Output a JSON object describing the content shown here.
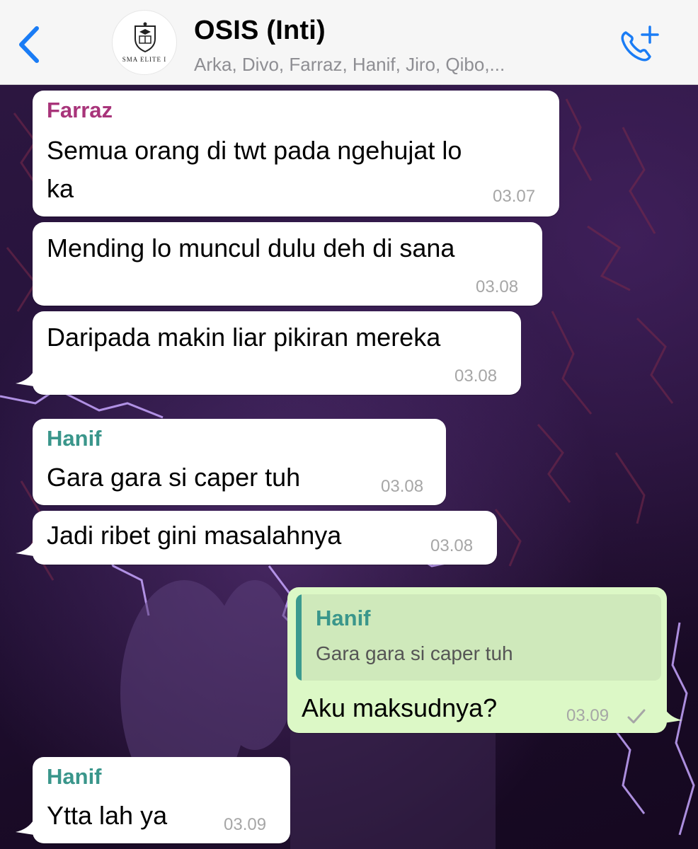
{
  "header": {
    "title": "OSIS (Inti)",
    "subtitle": "Arka, Divo, Farraz, Hanif, Jiro, Qibo,...",
    "avatar_text": "SMA ELITE I",
    "back_icon": "chevron-left-icon",
    "call_icon": "add-call-icon",
    "accent_color": "#1a7cf5"
  },
  "colors": {
    "farraz": "#a8347a",
    "hanif": "#3a968b",
    "incoming": "#ffffff",
    "outgoing": "#dcf8c6",
    "tick": "#a6a6a6"
  },
  "messages": [
    {
      "sender": "Farraz",
      "line1": "Semua orang di twt pada ngehujat lo",
      "line2": "ka",
      "time": "03.07"
    },
    {
      "text": "Mending lo muncul dulu deh di sana",
      "time": "03.08"
    },
    {
      "text": "Daripada makin liar pikiran mereka",
      "time": "03.08"
    },
    {
      "sender": "Hanif",
      "text": "Gara gara si caper tuh",
      "time": "03.08"
    },
    {
      "text": "Jadi ribet gini masalahnya",
      "time": "03.08"
    },
    {
      "quote_sender": "Hanif",
      "quote_text": "Gara gara si caper tuh",
      "text": "Aku maksudnya?",
      "time": "03.09",
      "status_icon": "sent-check-icon"
    },
    {
      "sender": "Hanif",
      "text": "Ytta lah ya",
      "time": "03.09"
    }
  ]
}
